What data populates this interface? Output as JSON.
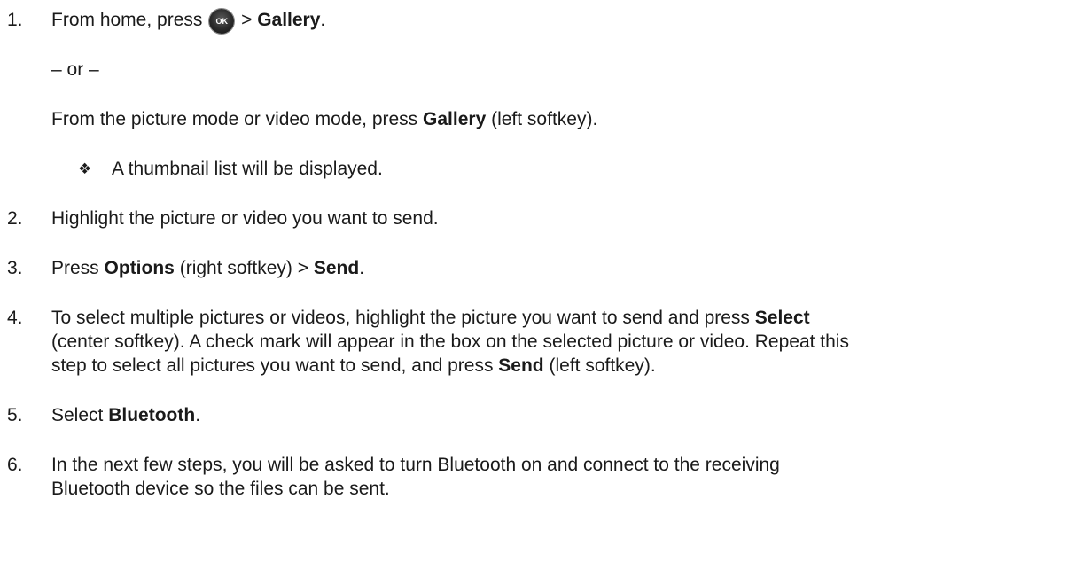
{
  "steps": [
    {
      "number": "1.",
      "pre": "From home, press",
      "icon_label": "OK",
      "sep": ">",
      "bold": "Gallery",
      "post": ".",
      "or": "– or –",
      "alt_pre": "From the picture mode or video mode, press",
      "alt_bold": "Gallery",
      "alt_post": "(left softkey).",
      "bullet_symbol": "❖",
      "bullet_text": "A thumbnail list will be displayed."
    },
    {
      "number": "2.",
      "text": "Highlight the picture or video you want to send."
    },
    {
      "number": "3.",
      "pre": "Press",
      "bold1": "Options",
      "mid": "(right softkey) >",
      "bold2": "Send",
      "post": "."
    },
    {
      "number": "4.",
      "line1_pre": "To select multiple pictures or videos, highlight the picture you want to send and press",
      "line1_bold": "Select",
      "line2": "(center softkey). A check mark will appear in the box on the selected picture or video. Repeat this",
      "line3_pre": "step to select all pictures you want to send, and press",
      "line3_bold": "Send",
      "line3_post": "(left softkey)."
    },
    {
      "number": "5.",
      "pre": "Select",
      "bold": "Bluetooth",
      "post": "."
    },
    {
      "number": "6.",
      "line1": "In the next few steps, you will be asked to turn Bluetooth on and connect to the receiving",
      "line2": "Bluetooth device so the files can be sent."
    }
  ]
}
